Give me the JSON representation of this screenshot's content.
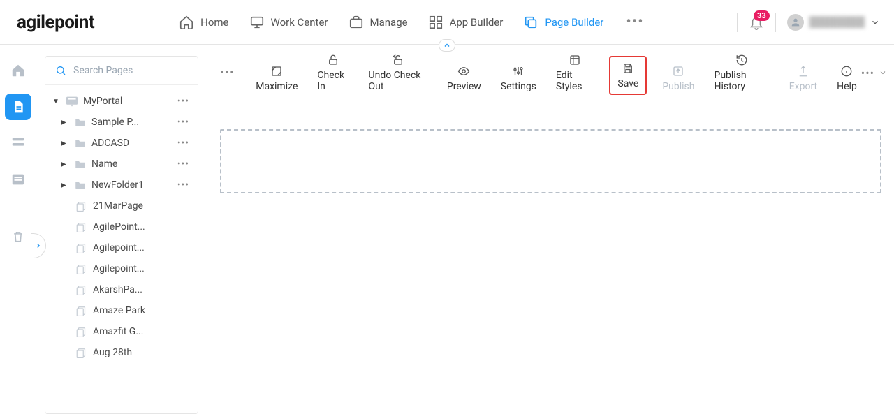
{
  "header": {
    "logo_text": "agilepoint",
    "nav": [
      {
        "label": "Home"
      },
      {
        "label": "Work Center"
      },
      {
        "label": "Manage"
      },
      {
        "label": "App Builder"
      },
      {
        "label": "Page Builder"
      }
    ],
    "notifications_count": "33",
    "user_name": "████████"
  },
  "sidebar": {
    "search_placeholder": "Search Pages",
    "tree": {
      "root": {
        "label": "MyPortal"
      },
      "folders": [
        {
          "label": "Sample P..."
        },
        {
          "label": "ADCASD"
        },
        {
          "label": "Name"
        },
        {
          "label": "NewFolder1"
        }
      ],
      "pages": [
        {
          "label": "21MarPage"
        },
        {
          "label": "AgilePoint..."
        },
        {
          "label": "Agilepoint..."
        },
        {
          "label": "Agilepoint..."
        },
        {
          "label": "AkarshPa..."
        },
        {
          "label": "Amaze Park"
        },
        {
          "label": "Amazfit G..."
        },
        {
          "label": "Aug 28th"
        }
      ]
    }
  },
  "toolbar": {
    "actions": [
      {
        "label": "Maximize"
      },
      {
        "label": "Check In"
      },
      {
        "label": "Undo Check Out"
      },
      {
        "label": "Preview"
      },
      {
        "label": "Settings"
      },
      {
        "label": "Edit Styles"
      },
      {
        "label": "Save"
      },
      {
        "label": "Publish"
      },
      {
        "label": "Publish History"
      },
      {
        "label": "Export"
      },
      {
        "label": "Help"
      }
    ]
  }
}
